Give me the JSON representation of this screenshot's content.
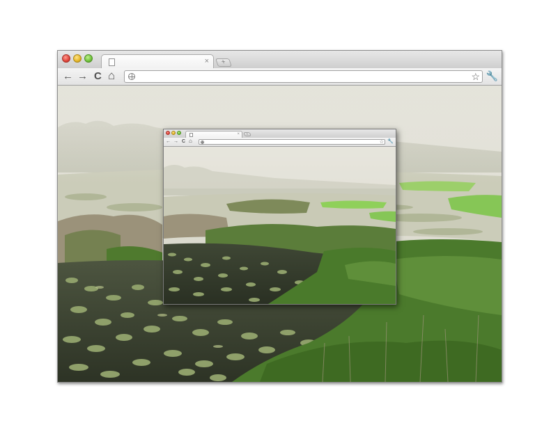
{
  "outer_browser": {
    "tab": {
      "title": "",
      "close_glyph": "×"
    },
    "newtab_glyph": "+",
    "nav": {
      "back": "←",
      "forward": "→",
      "reload": "C",
      "home": "⌂"
    },
    "omnibox": {
      "url": ""
    },
    "star_glyph": "☆",
    "wrench_glyph": "🔧"
  },
  "inner_browser": {
    "tab": {
      "title": "",
      "close_glyph": "×"
    },
    "newtab_glyph": "+",
    "nav": {
      "back": "←",
      "forward": "→",
      "reload": "C",
      "home": "⌂"
    },
    "omnibox": {
      "url": ""
    },
    "star_glyph": "☆",
    "wrench_glyph": "🔧"
  },
  "colors": {
    "fog": "#dcdcd0",
    "water": "#3d4632",
    "lily": "#8fa06a",
    "marsh_green": "#5f8f3a",
    "bright_grass": "#8fd05a",
    "reeds": "#a39982"
  }
}
